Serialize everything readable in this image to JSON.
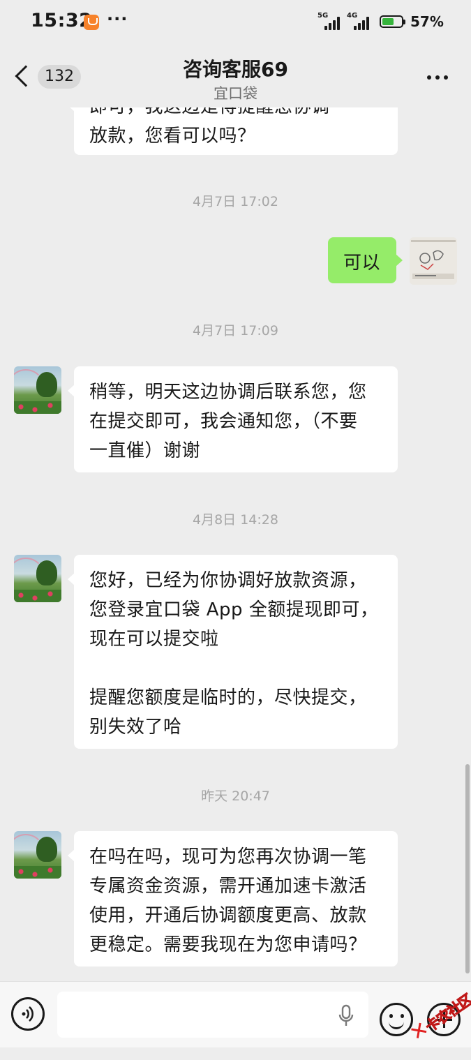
{
  "status_bar": {
    "time": "15:32",
    "more": "···",
    "network_1": "5G",
    "network_2": "4G",
    "battery_percent": "57%",
    "battery_color": "#36b43c"
  },
  "header": {
    "unread_count": "132",
    "title": "咨询客服69",
    "subtitle": "宜口袋"
  },
  "messages": [
    {
      "side": "left",
      "lines": [
        "即可，我这边是得提醒您协调",
        "放款，您看可以吗？"
      ]
    },
    {
      "type": "timestamp",
      "text": "4月7日 17:02"
    },
    {
      "side": "right",
      "lines": [
        "可以"
      ]
    },
    {
      "type": "timestamp",
      "text": "4月7日 17:09"
    },
    {
      "side": "left",
      "lines": [
        "稍等，明天这边协调后联系您，您",
        "在提交即可，我会通知您，（不要",
        "一直催）谢谢"
      ]
    },
    {
      "type": "timestamp",
      "text": "4月8日 14:28"
    },
    {
      "side": "left",
      "lines": [
        "您好，已经为你协调好放款资源，",
        "您登录宜口袋 App 全额提现即可，",
        "现在可以提交啦",
        "",
        "提醒您额度是临时的，尽快提交，",
        "别失效了哈"
      ]
    },
    {
      "type": "timestamp",
      "text": "昨天 20:47"
    },
    {
      "side": "left",
      "lines": [
        "在吗在吗，现可为您再次协调一笔",
        "专属资金资源，需开通加速卡激活",
        "使用，开通后协调额度更高、放款",
        "更稳定。需要我现在为您申请吗？"
      ]
    }
  ],
  "colors": {
    "background": "#ededed",
    "bubble_in": "#ffffff",
    "bubble_out": "#95ec69"
  },
  "input_bar": {
    "icons": [
      "voice-icon",
      "microphone-icon",
      "emoji-icon",
      "plus-icon"
    ]
  },
  "watermark": {
    "text": "卡农社区"
  }
}
